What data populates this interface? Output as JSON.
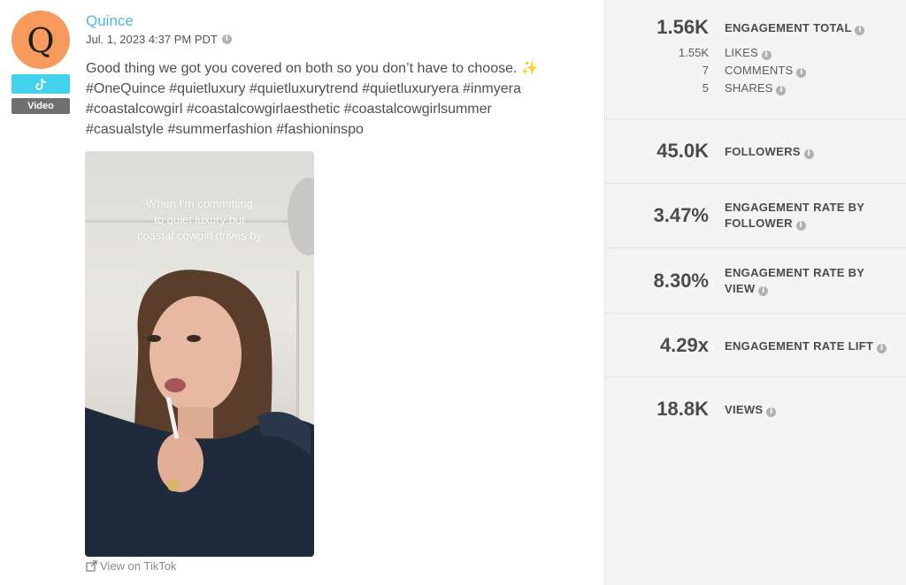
{
  "post": {
    "author": "Quince",
    "avatar_letter": "Q",
    "avatar_color": "#f79a5e",
    "platform_icon": "tiktok-icon",
    "platform_color": "#43d2ee",
    "type_label": "Video",
    "date": "Jul. 1, 2023 4:37 PM PDT",
    "caption_lines": [
      "Good thing we got you covered on both so you don’t have to choose.",
      "#OneQuince #quietluxury #quietluxurytrend #quietluxuryera #inmyera",
      "#coastalcowgirl #coastalcowgirlaesthetic #coastalcowgirlsummer",
      "#casualstyle #summerfashion #fashioninspo"
    ],
    "caption_emoji": "✨",
    "video_overlay_lines": [
      "When I'm committing",
      "to quiet luxury but",
      "coastal cowgirl drives by"
    ],
    "view_link": "View on TikTok"
  },
  "metrics": {
    "engagement_total": {
      "value": "1.56K",
      "label": "ENGAGEMENT TOTAL"
    },
    "likes": {
      "value": "1.55K",
      "label": "LIKES"
    },
    "comments": {
      "value": "7",
      "label": "COMMENTS"
    },
    "shares": {
      "value": "5",
      "label": "SHARES"
    },
    "followers": {
      "value": "45.0K",
      "label": "FOLLOWERS"
    },
    "er_follower": {
      "value": "3.47%",
      "label_line1": "ENGAGEMENT RATE BY",
      "label_line2": "FOLLOWER"
    },
    "er_view": {
      "value": "8.30%",
      "label_line1": "ENGAGEMENT RATE BY",
      "label_line2": "VIEW"
    },
    "er_lift": {
      "value": "4.29x",
      "label": "ENGAGEMENT RATE LIFT"
    },
    "views": {
      "value": "18.8K",
      "label": "VIEWS"
    }
  },
  "colors": {
    "link": "#56b3e8",
    "panel_bg": "#f4f4f4",
    "info_icon": "#b2b2b2"
  }
}
